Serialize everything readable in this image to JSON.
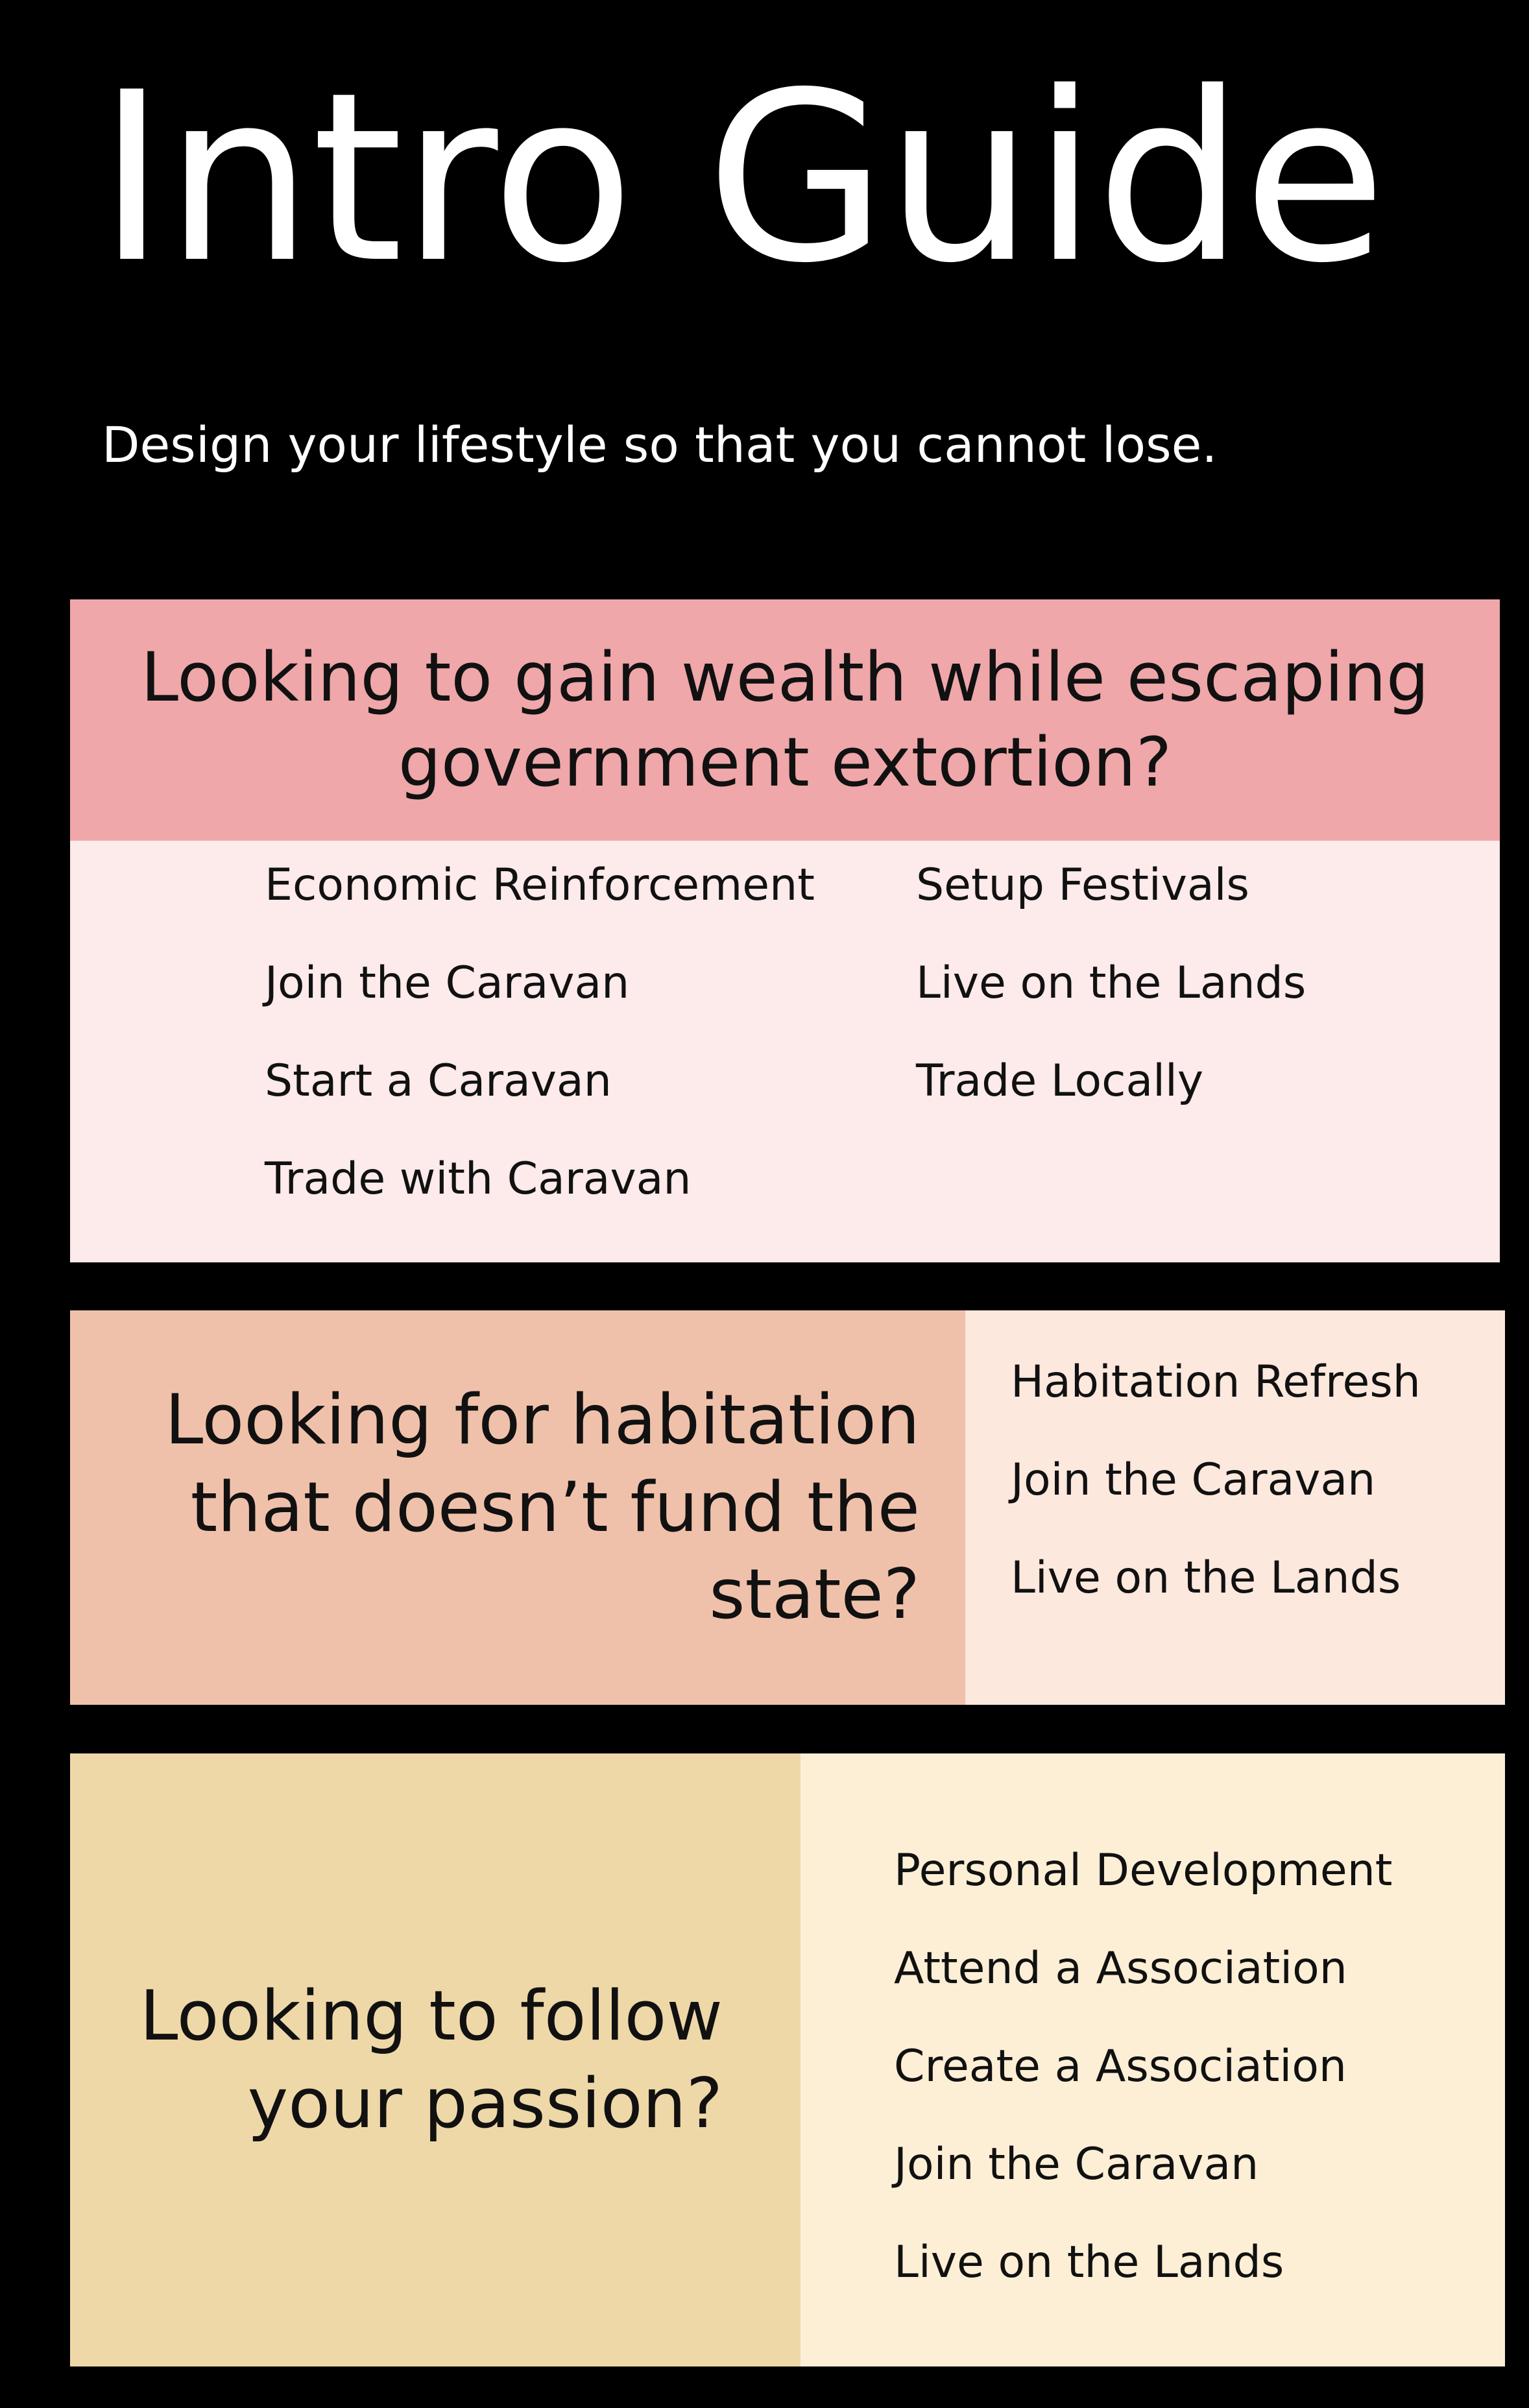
{
  "header": {
    "title": "Intro Guide",
    "subtitle": "Design your lifestyle so that you cannot lose."
  },
  "colors": {
    "background": "#000000",
    "wealth_header": "#efa7a9",
    "wealth_body": "#fdeaea",
    "habitation_header": "#f0c1aa",
    "habitation_body": "#fde8de",
    "passion_header": "#efd8a8",
    "passion_body": "#fdefd6"
  },
  "sections": [
    {
      "question": "Looking to gain wealth while escaping government extortion?",
      "options": [
        "Economic Reinforcement",
        "Join the Caravan",
        "Start a Caravan",
        "Trade with Caravan",
        "Setup Festivals",
        "Live on the Lands",
        "Trade Locally"
      ]
    },
    {
      "question": "Looking for habitation that doesn’t fund the state?",
      "options": [
        "Habitation Refresh",
        "Join the Caravan",
        "Live on the Lands"
      ]
    },
    {
      "question": "Looking to follow your passion?",
      "options": [
        "Personal Development",
        "Attend a Association",
        "Create a Association",
        "Join the Caravan",
        "Live on the Lands"
      ]
    }
  ]
}
